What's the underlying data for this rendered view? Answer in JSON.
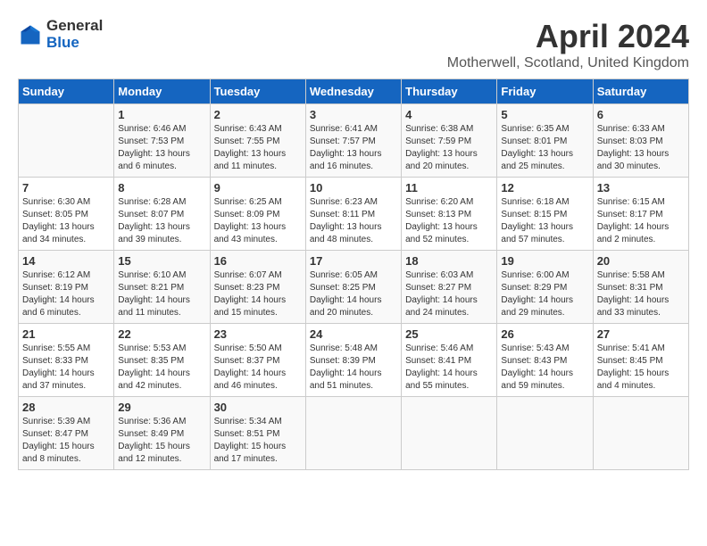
{
  "header": {
    "logo_general": "General",
    "logo_blue": "Blue",
    "month_title": "April 2024",
    "location": "Motherwell, Scotland, United Kingdom"
  },
  "weekdays": [
    "Sunday",
    "Monday",
    "Tuesday",
    "Wednesday",
    "Thursday",
    "Friday",
    "Saturday"
  ],
  "weeks": [
    [
      {
        "day": "",
        "sunrise": "",
        "sunset": "",
        "daylight": ""
      },
      {
        "day": "1",
        "sunrise": "Sunrise: 6:46 AM",
        "sunset": "Sunset: 7:53 PM",
        "daylight": "Daylight: 13 hours and 6 minutes."
      },
      {
        "day": "2",
        "sunrise": "Sunrise: 6:43 AM",
        "sunset": "Sunset: 7:55 PM",
        "daylight": "Daylight: 13 hours and 11 minutes."
      },
      {
        "day": "3",
        "sunrise": "Sunrise: 6:41 AM",
        "sunset": "Sunset: 7:57 PM",
        "daylight": "Daylight: 13 hours and 16 minutes."
      },
      {
        "day": "4",
        "sunrise": "Sunrise: 6:38 AM",
        "sunset": "Sunset: 7:59 PM",
        "daylight": "Daylight: 13 hours and 20 minutes."
      },
      {
        "day": "5",
        "sunrise": "Sunrise: 6:35 AM",
        "sunset": "Sunset: 8:01 PM",
        "daylight": "Daylight: 13 hours and 25 minutes."
      },
      {
        "day": "6",
        "sunrise": "Sunrise: 6:33 AM",
        "sunset": "Sunset: 8:03 PM",
        "daylight": "Daylight: 13 hours and 30 minutes."
      }
    ],
    [
      {
        "day": "7",
        "sunrise": "Sunrise: 6:30 AM",
        "sunset": "Sunset: 8:05 PM",
        "daylight": "Daylight: 13 hours and 34 minutes."
      },
      {
        "day": "8",
        "sunrise": "Sunrise: 6:28 AM",
        "sunset": "Sunset: 8:07 PM",
        "daylight": "Daylight: 13 hours and 39 minutes."
      },
      {
        "day": "9",
        "sunrise": "Sunrise: 6:25 AM",
        "sunset": "Sunset: 8:09 PM",
        "daylight": "Daylight: 13 hours and 43 minutes."
      },
      {
        "day": "10",
        "sunrise": "Sunrise: 6:23 AM",
        "sunset": "Sunset: 8:11 PM",
        "daylight": "Daylight: 13 hours and 48 minutes."
      },
      {
        "day": "11",
        "sunrise": "Sunrise: 6:20 AM",
        "sunset": "Sunset: 8:13 PM",
        "daylight": "Daylight: 13 hours and 52 minutes."
      },
      {
        "day": "12",
        "sunrise": "Sunrise: 6:18 AM",
        "sunset": "Sunset: 8:15 PM",
        "daylight": "Daylight: 13 hours and 57 minutes."
      },
      {
        "day": "13",
        "sunrise": "Sunrise: 6:15 AM",
        "sunset": "Sunset: 8:17 PM",
        "daylight": "Daylight: 14 hours and 2 minutes."
      }
    ],
    [
      {
        "day": "14",
        "sunrise": "Sunrise: 6:12 AM",
        "sunset": "Sunset: 8:19 PM",
        "daylight": "Daylight: 14 hours and 6 minutes."
      },
      {
        "day": "15",
        "sunrise": "Sunrise: 6:10 AM",
        "sunset": "Sunset: 8:21 PM",
        "daylight": "Daylight: 14 hours and 11 minutes."
      },
      {
        "day": "16",
        "sunrise": "Sunrise: 6:07 AM",
        "sunset": "Sunset: 8:23 PM",
        "daylight": "Daylight: 14 hours and 15 minutes."
      },
      {
        "day": "17",
        "sunrise": "Sunrise: 6:05 AM",
        "sunset": "Sunset: 8:25 PM",
        "daylight": "Daylight: 14 hours and 20 minutes."
      },
      {
        "day": "18",
        "sunrise": "Sunrise: 6:03 AM",
        "sunset": "Sunset: 8:27 PM",
        "daylight": "Daylight: 14 hours and 24 minutes."
      },
      {
        "day": "19",
        "sunrise": "Sunrise: 6:00 AM",
        "sunset": "Sunset: 8:29 PM",
        "daylight": "Daylight: 14 hours and 29 minutes."
      },
      {
        "day": "20",
        "sunrise": "Sunrise: 5:58 AM",
        "sunset": "Sunset: 8:31 PM",
        "daylight": "Daylight: 14 hours and 33 minutes."
      }
    ],
    [
      {
        "day": "21",
        "sunrise": "Sunrise: 5:55 AM",
        "sunset": "Sunset: 8:33 PM",
        "daylight": "Daylight: 14 hours and 37 minutes."
      },
      {
        "day": "22",
        "sunrise": "Sunrise: 5:53 AM",
        "sunset": "Sunset: 8:35 PM",
        "daylight": "Daylight: 14 hours and 42 minutes."
      },
      {
        "day": "23",
        "sunrise": "Sunrise: 5:50 AM",
        "sunset": "Sunset: 8:37 PM",
        "daylight": "Daylight: 14 hours and 46 minutes."
      },
      {
        "day": "24",
        "sunrise": "Sunrise: 5:48 AM",
        "sunset": "Sunset: 8:39 PM",
        "daylight": "Daylight: 14 hours and 51 minutes."
      },
      {
        "day": "25",
        "sunrise": "Sunrise: 5:46 AM",
        "sunset": "Sunset: 8:41 PM",
        "daylight": "Daylight: 14 hours and 55 minutes."
      },
      {
        "day": "26",
        "sunrise": "Sunrise: 5:43 AM",
        "sunset": "Sunset: 8:43 PM",
        "daylight": "Daylight: 14 hours and 59 minutes."
      },
      {
        "day": "27",
        "sunrise": "Sunrise: 5:41 AM",
        "sunset": "Sunset: 8:45 PM",
        "daylight": "Daylight: 15 hours and 4 minutes."
      }
    ],
    [
      {
        "day": "28",
        "sunrise": "Sunrise: 5:39 AM",
        "sunset": "Sunset: 8:47 PM",
        "daylight": "Daylight: 15 hours and 8 minutes."
      },
      {
        "day": "29",
        "sunrise": "Sunrise: 5:36 AM",
        "sunset": "Sunset: 8:49 PM",
        "daylight": "Daylight: 15 hours and 12 minutes."
      },
      {
        "day": "30",
        "sunrise": "Sunrise: 5:34 AM",
        "sunset": "Sunset: 8:51 PM",
        "daylight": "Daylight: 15 hours and 17 minutes."
      },
      {
        "day": "",
        "sunrise": "",
        "sunset": "",
        "daylight": ""
      },
      {
        "day": "",
        "sunrise": "",
        "sunset": "",
        "daylight": ""
      },
      {
        "day": "",
        "sunrise": "",
        "sunset": "",
        "daylight": ""
      },
      {
        "day": "",
        "sunrise": "",
        "sunset": "",
        "daylight": ""
      }
    ]
  ]
}
